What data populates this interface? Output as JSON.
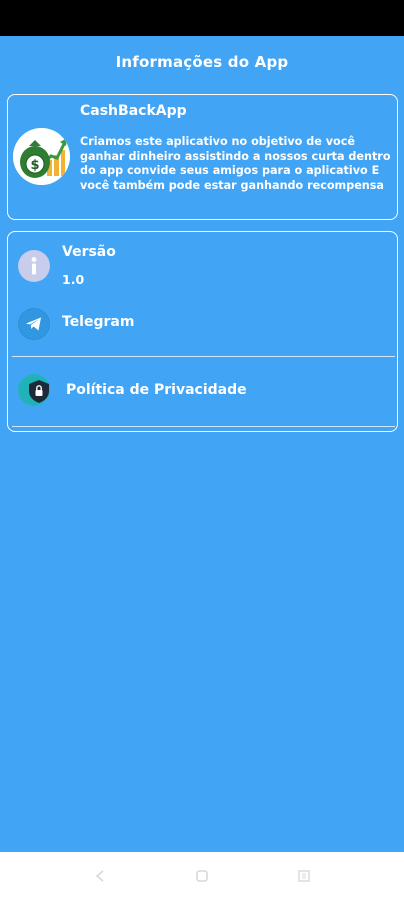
{
  "header": {
    "title": "Informações do App"
  },
  "app_card": {
    "name": "CashBackApp",
    "description": "Criamos este aplicativo no objetivo de você ganhar dinheiro assistindo a nossos curta dentro do app convide seus amigos para o aplicativo E você também pode estar ganhando recompensa",
    "logo_icon": "money-growth-icon"
  },
  "info_card": {
    "version_label": "Versão",
    "version_value": "1.0",
    "telegram_label": "Telegram",
    "privacy_label": "Política de Privacidade",
    "icons": {
      "version": "info-icon",
      "telegram": "telegram-icon",
      "privacy": "shield-lock-icon"
    }
  },
  "nav": {
    "back_icon": "back-icon",
    "home_icon": "home-icon",
    "recents_icon": "recents-icon"
  },
  "colors": {
    "background": "#42a4f5",
    "status_bar": "#000000",
    "nav_bar": "#ffffff",
    "text": "#ffffff"
  }
}
